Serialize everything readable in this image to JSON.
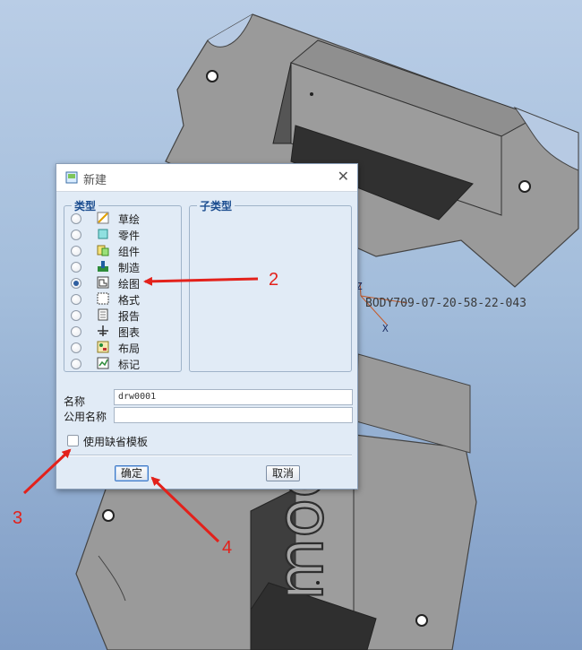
{
  "model": {
    "name_label": "BODY709-07-20-58-22-043",
    "embossed_text": "moogle",
    "axis_z": "Z",
    "axis_x": "X"
  },
  "dialog": {
    "title": "新建",
    "type_group_title": "类型",
    "subtype_group_title": "子类型",
    "types": [
      {
        "label": "草绘",
        "icon": "sketch-icon",
        "selected": false
      },
      {
        "label": "零件",
        "icon": "part-icon",
        "selected": false
      },
      {
        "label": "组件",
        "icon": "assembly-icon",
        "selected": false
      },
      {
        "label": "制造",
        "icon": "manufacturing-icon",
        "selected": false
      },
      {
        "label": "绘图",
        "icon": "drawing-icon",
        "selected": true
      },
      {
        "label": "格式",
        "icon": "format-icon",
        "selected": false
      },
      {
        "label": "报告",
        "icon": "report-icon",
        "selected": false
      },
      {
        "label": "图表",
        "icon": "diagram-icon",
        "selected": false
      },
      {
        "label": "布局",
        "icon": "layout-icon",
        "selected": false
      },
      {
        "label": "标记",
        "icon": "markup-icon",
        "selected": false
      }
    ],
    "name_label": "名称",
    "name_value": "drw0001",
    "common_name_label": "公用名称",
    "common_name_value": "",
    "use_default_template_label": "使用缺省模板",
    "use_default_template_checked": false,
    "ok_label": "确定",
    "cancel_label": "取消"
  },
  "annotations": {
    "label_2": "2",
    "label_3": "3",
    "label_4": "4",
    "color": "#e3211b"
  }
}
